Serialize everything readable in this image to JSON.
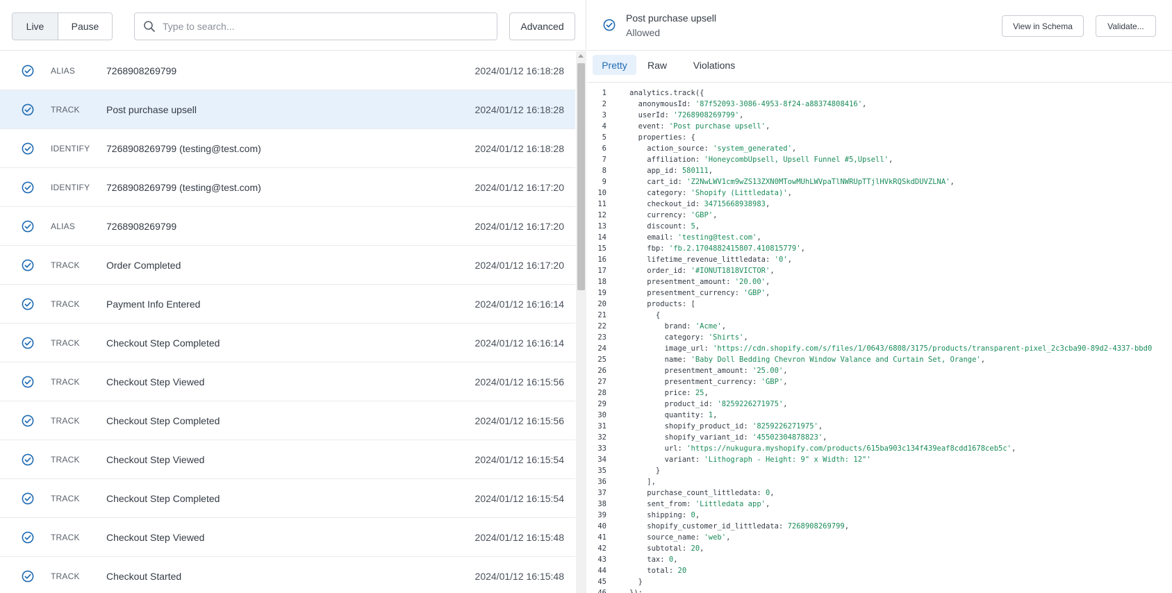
{
  "toolbar": {
    "live_label": "Live",
    "pause_label": "Pause",
    "search_placeholder": "Type to search...",
    "advanced_label": "Advanced"
  },
  "events": [
    {
      "type": "ALIAS",
      "name": "7268908269799",
      "time": "2024/01/12 16:18:28",
      "selected": false
    },
    {
      "type": "TRACK",
      "name": "Post purchase upsell",
      "time": "2024/01/12 16:18:28",
      "selected": true
    },
    {
      "type": "IDENTIFY",
      "name": "7268908269799 (testing@test.com)",
      "time": "2024/01/12 16:18:28",
      "selected": false
    },
    {
      "type": "IDENTIFY",
      "name": "7268908269799 (testing@test.com)",
      "time": "2024/01/12 16:17:20",
      "selected": false
    },
    {
      "type": "ALIAS",
      "name": "7268908269799",
      "time": "2024/01/12 16:17:20",
      "selected": false
    },
    {
      "type": "TRACK",
      "name": "Order Completed",
      "time": "2024/01/12 16:17:20",
      "selected": false
    },
    {
      "type": "TRACK",
      "name": "Payment Info Entered",
      "time": "2024/01/12 16:16:14",
      "selected": false
    },
    {
      "type": "TRACK",
      "name": "Checkout Step Completed",
      "time": "2024/01/12 16:16:14",
      "selected": false
    },
    {
      "type": "TRACK",
      "name": "Checkout Step Viewed",
      "time": "2024/01/12 16:15:56",
      "selected": false
    },
    {
      "type": "TRACK",
      "name": "Checkout Step Completed",
      "time": "2024/01/12 16:15:56",
      "selected": false
    },
    {
      "type": "TRACK",
      "name": "Checkout Step Viewed",
      "time": "2024/01/12 16:15:54",
      "selected": false
    },
    {
      "type": "TRACK",
      "name": "Checkout Step Completed",
      "time": "2024/01/12 16:15:54",
      "selected": false
    },
    {
      "type": "TRACK",
      "name": "Checkout Step Viewed",
      "time": "2024/01/12 16:15:48",
      "selected": false
    },
    {
      "type": "TRACK",
      "name": "Checkout Started",
      "time": "2024/01/12 16:15:48",
      "selected": false
    }
  ],
  "detail": {
    "title": "Post purchase upsell",
    "status": "Allowed",
    "view_schema_label": "View in Schema",
    "validate_label": "Validate...",
    "tabs": [
      "Pretty",
      "Raw",
      "Violations"
    ],
    "active_tab": "Pretty"
  },
  "code_lines": [
    [
      "analytics.track({",
      "",
      ""
    ],
    [
      "  anonymousId: ",
      "'87f52093-3086-4953-8f24-a88374808416'",
      ","
    ],
    [
      "  userId: ",
      "'7268908269799'",
      ","
    ],
    [
      "  event: ",
      "'Post purchase upsell'",
      ","
    ],
    [
      "  properties: {",
      "",
      ""
    ],
    [
      "    action_source: ",
      "'system_generated'",
      ","
    ],
    [
      "    affiliation: ",
      "'HoneycombUpsell, Upsell Funnel #5,Upsell'",
      ","
    ],
    [
      "    app_id: ",
      "580111",
      ","
    ],
    [
      "    cart_id: ",
      "'Z2NwLWV1cm9wZS13ZXN0MTowMUhLWVpaTlNWRUpTTjlHVkRQSkdDUVZLNA'",
      ","
    ],
    [
      "    category: ",
      "'Shopify (Littledata)'",
      ","
    ],
    [
      "    checkout_id: ",
      "34715668938983",
      ","
    ],
    [
      "    currency: ",
      "'GBP'",
      ","
    ],
    [
      "    discount: ",
      "5",
      ","
    ],
    [
      "    email: ",
      "'testing@test.com'",
      ","
    ],
    [
      "    fbp: ",
      "'fb.2.1704882415807.410815779'",
      ","
    ],
    [
      "    lifetime_revenue_littledata: ",
      "'0'",
      ","
    ],
    [
      "    order_id: ",
      "'#IONUT1818VICTOR'",
      ","
    ],
    [
      "    presentment_amount: ",
      "'20.00'",
      ","
    ],
    [
      "    presentment_currency: ",
      "'GBP'",
      ","
    ],
    [
      "    products: [",
      "",
      ""
    ],
    [
      "      {",
      "",
      ""
    ],
    [
      "        brand: ",
      "'Acme'",
      ","
    ],
    [
      "        category: ",
      "'Shirts'",
      ","
    ],
    [
      "        image_url: ",
      "'https://cdn.shopify.com/s/files/1/0643/6808/3175/products/transparent-pixel_2c3cba90-89d2-4337-bbd0",
      ""
    ],
    [
      "        name: ",
      "'Baby Doll Bedding Chevron Window Valance and Curtain Set, Orange'",
      ","
    ],
    [
      "        presentment_amount: ",
      "'25.00'",
      ","
    ],
    [
      "        presentment_currency: ",
      "'GBP'",
      ","
    ],
    [
      "        price: ",
      "25",
      ","
    ],
    [
      "        product_id: ",
      "'8259226271975'",
      ","
    ],
    [
      "        quantity: ",
      "1",
      ","
    ],
    [
      "        shopify_product_id: ",
      "'8259226271975'",
      ","
    ],
    [
      "        shopify_variant_id: ",
      "'45502304878823'",
      ","
    ],
    [
      "        url: ",
      "'https://nukugura.myshopify.com/products/615ba903c134f439eaf8cdd1678ceb5c'",
      ","
    ],
    [
      "        variant: ",
      "'Lithograph - Height: 9\" x Width: 12\"'",
      ""
    ],
    [
      "      }",
      "",
      ""
    ],
    [
      "    ],",
      "",
      ""
    ],
    [
      "    purchase_count_littledata: ",
      "0",
      ","
    ],
    [
      "    sent_from: ",
      "'Littledata app'",
      ","
    ],
    [
      "    shipping: ",
      "0",
      ","
    ],
    [
      "    shopify_customer_id_littledata: ",
      "7268908269799",
      ","
    ],
    [
      "    source_name: ",
      "'web'",
      ","
    ],
    [
      "    subtotal: ",
      "20",
      ","
    ],
    [
      "    tax: ",
      "0",
      ","
    ],
    [
      "    total: ",
      "20",
      ""
    ],
    [
      "  }",
      "",
      ""
    ],
    [
      "});",
      "",
      ""
    ]
  ],
  "colors": {
    "accent": "#1f6bb3",
    "selected_row": "#e7f1fb",
    "string": "#1a8c5b"
  }
}
